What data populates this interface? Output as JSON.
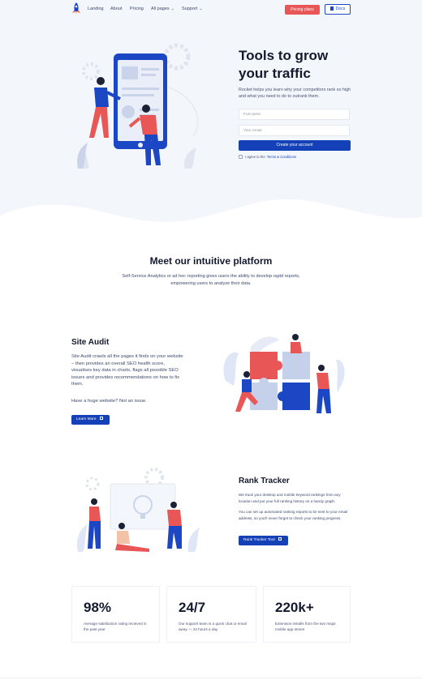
{
  "nav": {
    "links": [
      {
        "label": "Landing"
      },
      {
        "label": "About"
      },
      {
        "label": "Pricing"
      },
      {
        "label": "All pages",
        "chevron": "⌄"
      },
      {
        "label": "Support",
        "chevron": "⌄"
      }
    ],
    "pricing_button": "Pricing plans",
    "docs_button": "Docs"
  },
  "hero": {
    "title": "Tools to grow your traffic",
    "subtitle": "Rocket helps you learn why your competitors rank so high and what you need to do to outrank them.",
    "name_placeholder": "Full name",
    "email_placeholder": "Your email",
    "create_button": "Create your account",
    "agree_text": "I agree to the",
    "agree_link": "Terms & Conditions"
  },
  "platform": {
    "title": "Meet our intuitive platform",
    "description": "Self-Service Analytics or ad hoc reporting gives users the ability to develop rapid reports, empowering users to analyze their data."
  },
  "site_audit": {
    "title": "Site Audit",
    "text": "Site Audit crawls all the pages it finds on your website – then provides an overall SEO health score, visualises key data in charts, flags all possible SEO issues and provides recommendations on how to fix them.",
    "question": "Have a huge website? Not an issue.",
    "button": "Learn More"
  },
  "rank_tracker": {
    "title": "Rank Tracker",
    "p1": "We track your desktop and mobile keyword rankings from any location and put your full ranking history on a handy graph.",
    "p2": "You can set up automated ranking reports to be sent to your email address, so you'll never forget to check your ranking progress.",
    "button": "Rank Tracker Tool"
  },
  "stats": [
    {
      "value": "98%",
      "desc": "Average satisfaction rating received in the past year"
    },
    {
      "value": "24/7",
      "desc": "Our support team is a quick chat or email away — 24 hours a day"
    },
    {
      "value": "220k+",
      "desc": "Extension installs from the two major mobile app stores"
    }
  ],
  "colors": {
    "accent": "#1440b8",
    "pricing_red": "#e85656",
    "hero_bg": "#f3f6fb"
  }
}
